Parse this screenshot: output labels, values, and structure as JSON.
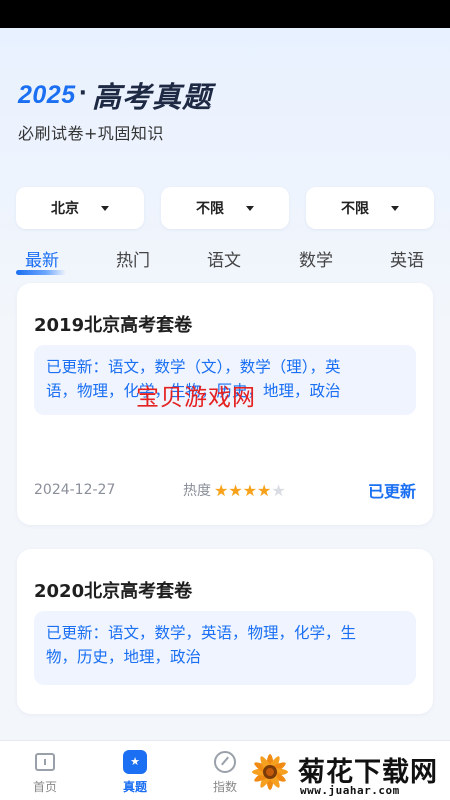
{
  "header": {
    "year": "2025",
    "separator": "·",
    "title": "高考真题",
    "subtitle": "必刷试卷+巩固知识"
  },
  "filters": [
    {
      "label": "北京",
      "icon": "caret-down-icon"
    },
    {
      "label": "不限",
      "icon": "caret-down-icon"
    },
    {
      "label": "不限",
      "icon": "caret-down-icon"
    }
  ],
  "tabs": [
    {
      "label": "最新",
      "active": true
    },
    {
      "label": "热门",
      "active": false
    },
    {
      "label": "语文",
      "active": false
    },
    {
      "label": "数学",
      "active": false
    },
    {
      "label": "英语",
      "active": false
    }
  ],
  "cards": [
    {
      "title": "2019北京高考套卷",
      "update_line1": "已更新：语文，数学（文），数学（理），英",
      "update_line2": "语，物理，化学，生物，历史，地理，政治",
      "date": "2024-12-27",
      "hot_label": "热度",
      "hot_rating": 4,
      "hot_max": 5,
      "status": "已更新"
    },
    {
      "title": "2020北京高考套卷",
      "update_line1": "已更新：语文，数学，英语，物理，化学，生",
      "update_line2": "物，历史，地理，政治"
    }
  ],
  "watermark": {
    "center_text": "宝贝游戏网",
    "logo_name": "菊花下载网",
    "logo_url": "www.juahar.com"
  },
  "bottom_nav": [
    {
      "label": "首页",
      "icon": "home-icon",
      "active": false
    },
    {
      "label": "真题",
      "icon": "exam-icon",
      "active": true
    },
    {
      "label": "指数",
      "icon": "index-icon",
      "active": false
    }
  ],
  "colors": {
    "accent": "#1a6ff2",
    "star": "#f7a21a",
    "watermark_red": "#e52222"
  }
}
